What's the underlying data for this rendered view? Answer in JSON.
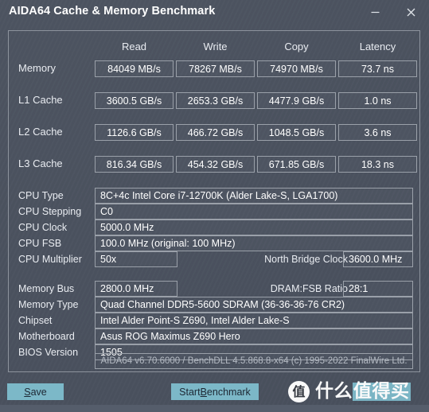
{
  "window": {
    "title": "AIDA64 Cache & Memory Benchmark",
    "minimize_label": "—",
    "close_label": "×"
  },
  "benchmark": {
    "columns": [
      "Read",
      "Write",
      "Copy",
      "Latency"
    ],
    "rows": [
      {
        "label": "Memory",
        "read": "84049 MB/s",
        "write": "78267 MB/s",
        "copy": "74970 MB/s",
        "latency": "73.7 ns"
      },
      {
        "label": "L1 Cache",
        "read": "3600.5 GB/s",
        "write": "2653.3 GB/s",
        "copy": "4477.9 GB/s",
        "latency": "1.0 ns"
      },
      {
        "label": "L2 Cache",
        "read": "1126.6 GB/s",
        "write": "466.72 GB/s",
        "copy": "1048.5 GB/s",
        "latency": "3.6 ns"
      },
      {
        "label": "L3 Cache",
        "read": "816.34 GB/s",
        "write": "454.32 GB/s",
        "copy": "671.85 GB/s",
        "latency": "18.3 ns"
      }
    ]
  },
  "cpu_info": {
    "type_label": "CPU Type",
    "type_value": "8C+4c Intel Core i7-12700K  (Alder Lake-S, LGA1700)",
    "stepping_label": "CPU Stepping",
    "stepping_value": "C0",
    "clock_label": "CPU Clock",
    "clock_value": "5000.0 MHz",
    "fsb_label": "CPU FSB",
    "fsb_value": "100.0 MHz  (original: 100 MHz)",
    "multiplier_label": "CPU Multiplier",
    "multiplier_value": "50x",
    "north_bridge_label": "North Bridge Clock",
    "north_bridge_value": "3600.0 MHz"
  },
  "memory_info": {
    "bus_label": "Memory Bus",
    "bus_value": "2800.0 MHz",
    "ratio_label": "DRAM:FSB Ratio",
    "ratio_value": "28:1",
    "type_label": "Memory Type",
    "type_value": "Quad Channel DDR5-5600 SDRAM  (36-36-36-76 CR2)",
    "chipset_label": "Chipset",
    "chipset_value": "Intel Alder Point-S Z690, Intel Alder Lake-S",
    "motherboard_label": "Motherboard",
    "motherboard_value": "Asus ROG Maximus Z690 Hero",
    "bios_label": "BIOS Version",
    "bios_value": "1505"
  },
  "footer": {
    "version_info": "AIDA64 v6.70.6000 / BenchDLL 4.5.868.8-x64  (c) 1995-2022 FinalWire Ltd.",
    "save_prefix": "",
    "save_accel": "S",
    "save_suffix": "ave",
    "start_prefix": "Start ",
    "start_accel": "B",
    "start_suffix": "enchmark"
  },
  "watermark": {
    "logo_char": "值",
    "text_plain": "什么",
    "text_highlight": "值得买"
  },
  "colors": {
    "background": "#4b525f",
    "accent": "#7cb8c8",
    "border": "#9aa0a9",
    "text": "#e9ecf1"
  }
}
